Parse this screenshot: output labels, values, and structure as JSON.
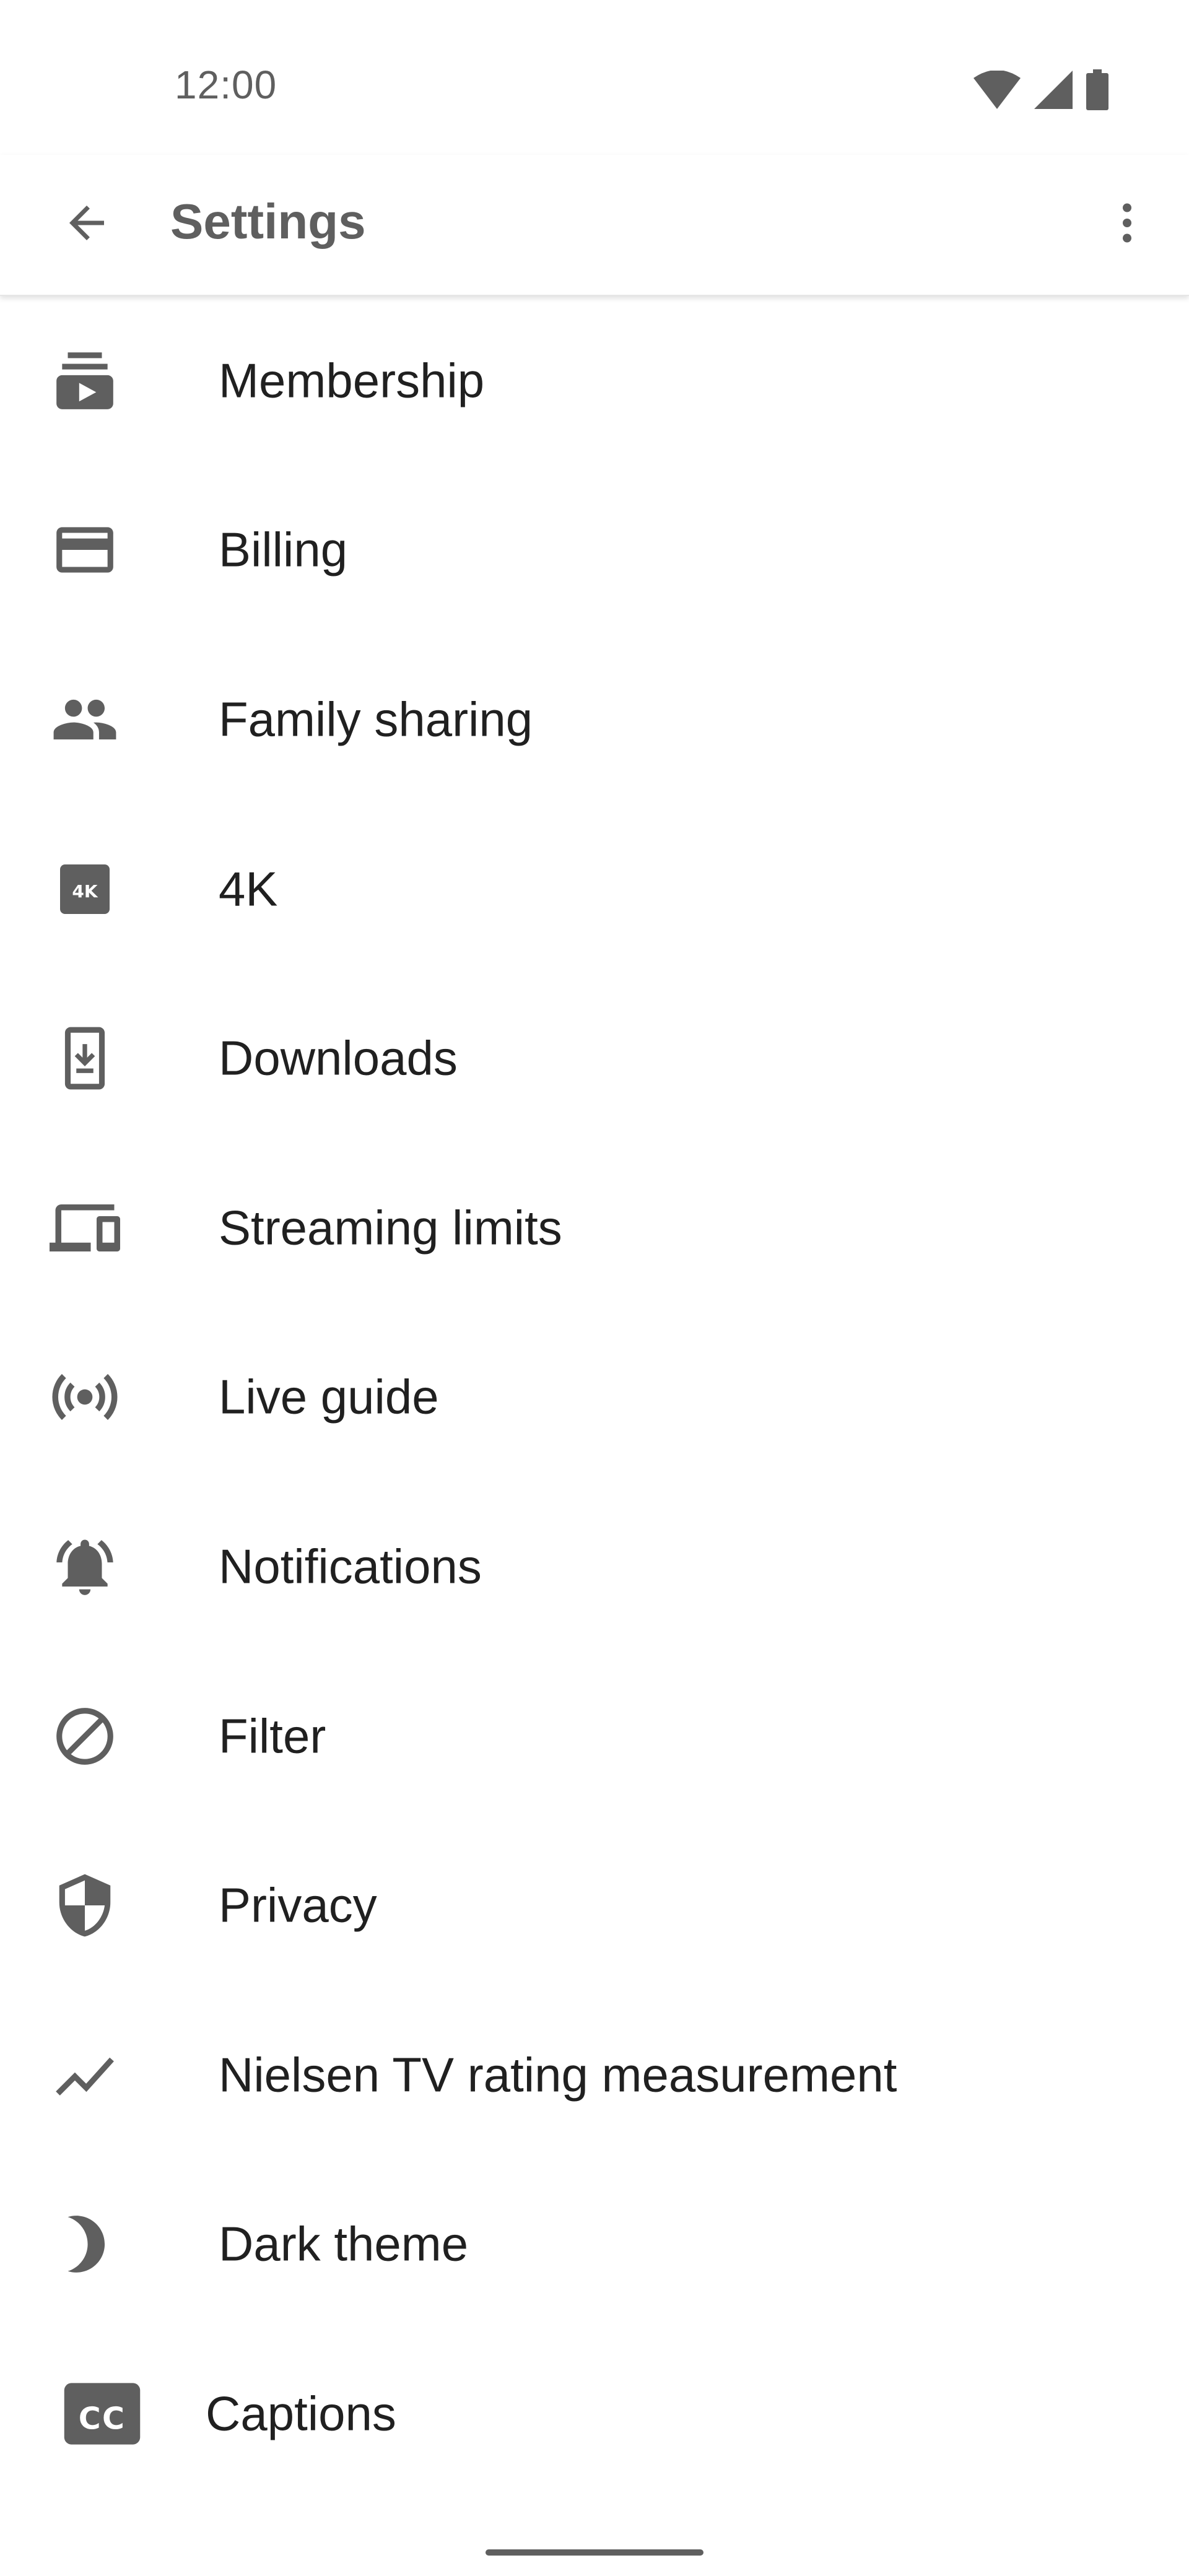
{
  "status_bar": {
    "time": "12:00",
    "icons": [
      "wifi-icon",
      "cellular-signal-icon",
      "battery-icon"
    ]
  },
  "app_bar": {
    "title": "Settings",
    "back_icon": "arrow-back-icon",
    "menu_icon": "more-vert-icon"
  },
  "colors": {
    "icon": "#5f5f5f",
    "text": "#202020",
    "background": "#ffffff"
  },
  "settings": {
    "items": [
      {
        "label": "Membership",
        "icon": "subscriptions-icon"
      },
      {
        "label": "Billing",
        "icon": "credit-card-icon"
      },
      {
        "label": "Family sharing",
        "icon": "people-icon"
      },
      {
        "label": "4K",
        "icon": "4k-icon"
      },
      {
        "label": "Downloads",
        "icon": "downloads-icon"
      },
      {
        "label": "Streaming limits",
        "icon": "devices-icon"
      },
      {
        "label": "Live guide",
        "icon": "live-broadcast-icon"
      },
      {
        "label": "Notifications",
        "icon": "notifications-icon"
      },
      {
        "label": "Filter",
        "icon": "block-icon"
      },
      {
        "label": "Privacy",
        "icon": "shield-icon"
      },
      {
        "label": "Nielsen TV rating measurement",
        "icon": "trending-icon"
      },
      {
        "label": "Dark theme",
        "icon": "moon-icon"
      },
      {
        "label": "Captions",
        "icon": "closed-caption-icon"
      }
    ]
  }
}
